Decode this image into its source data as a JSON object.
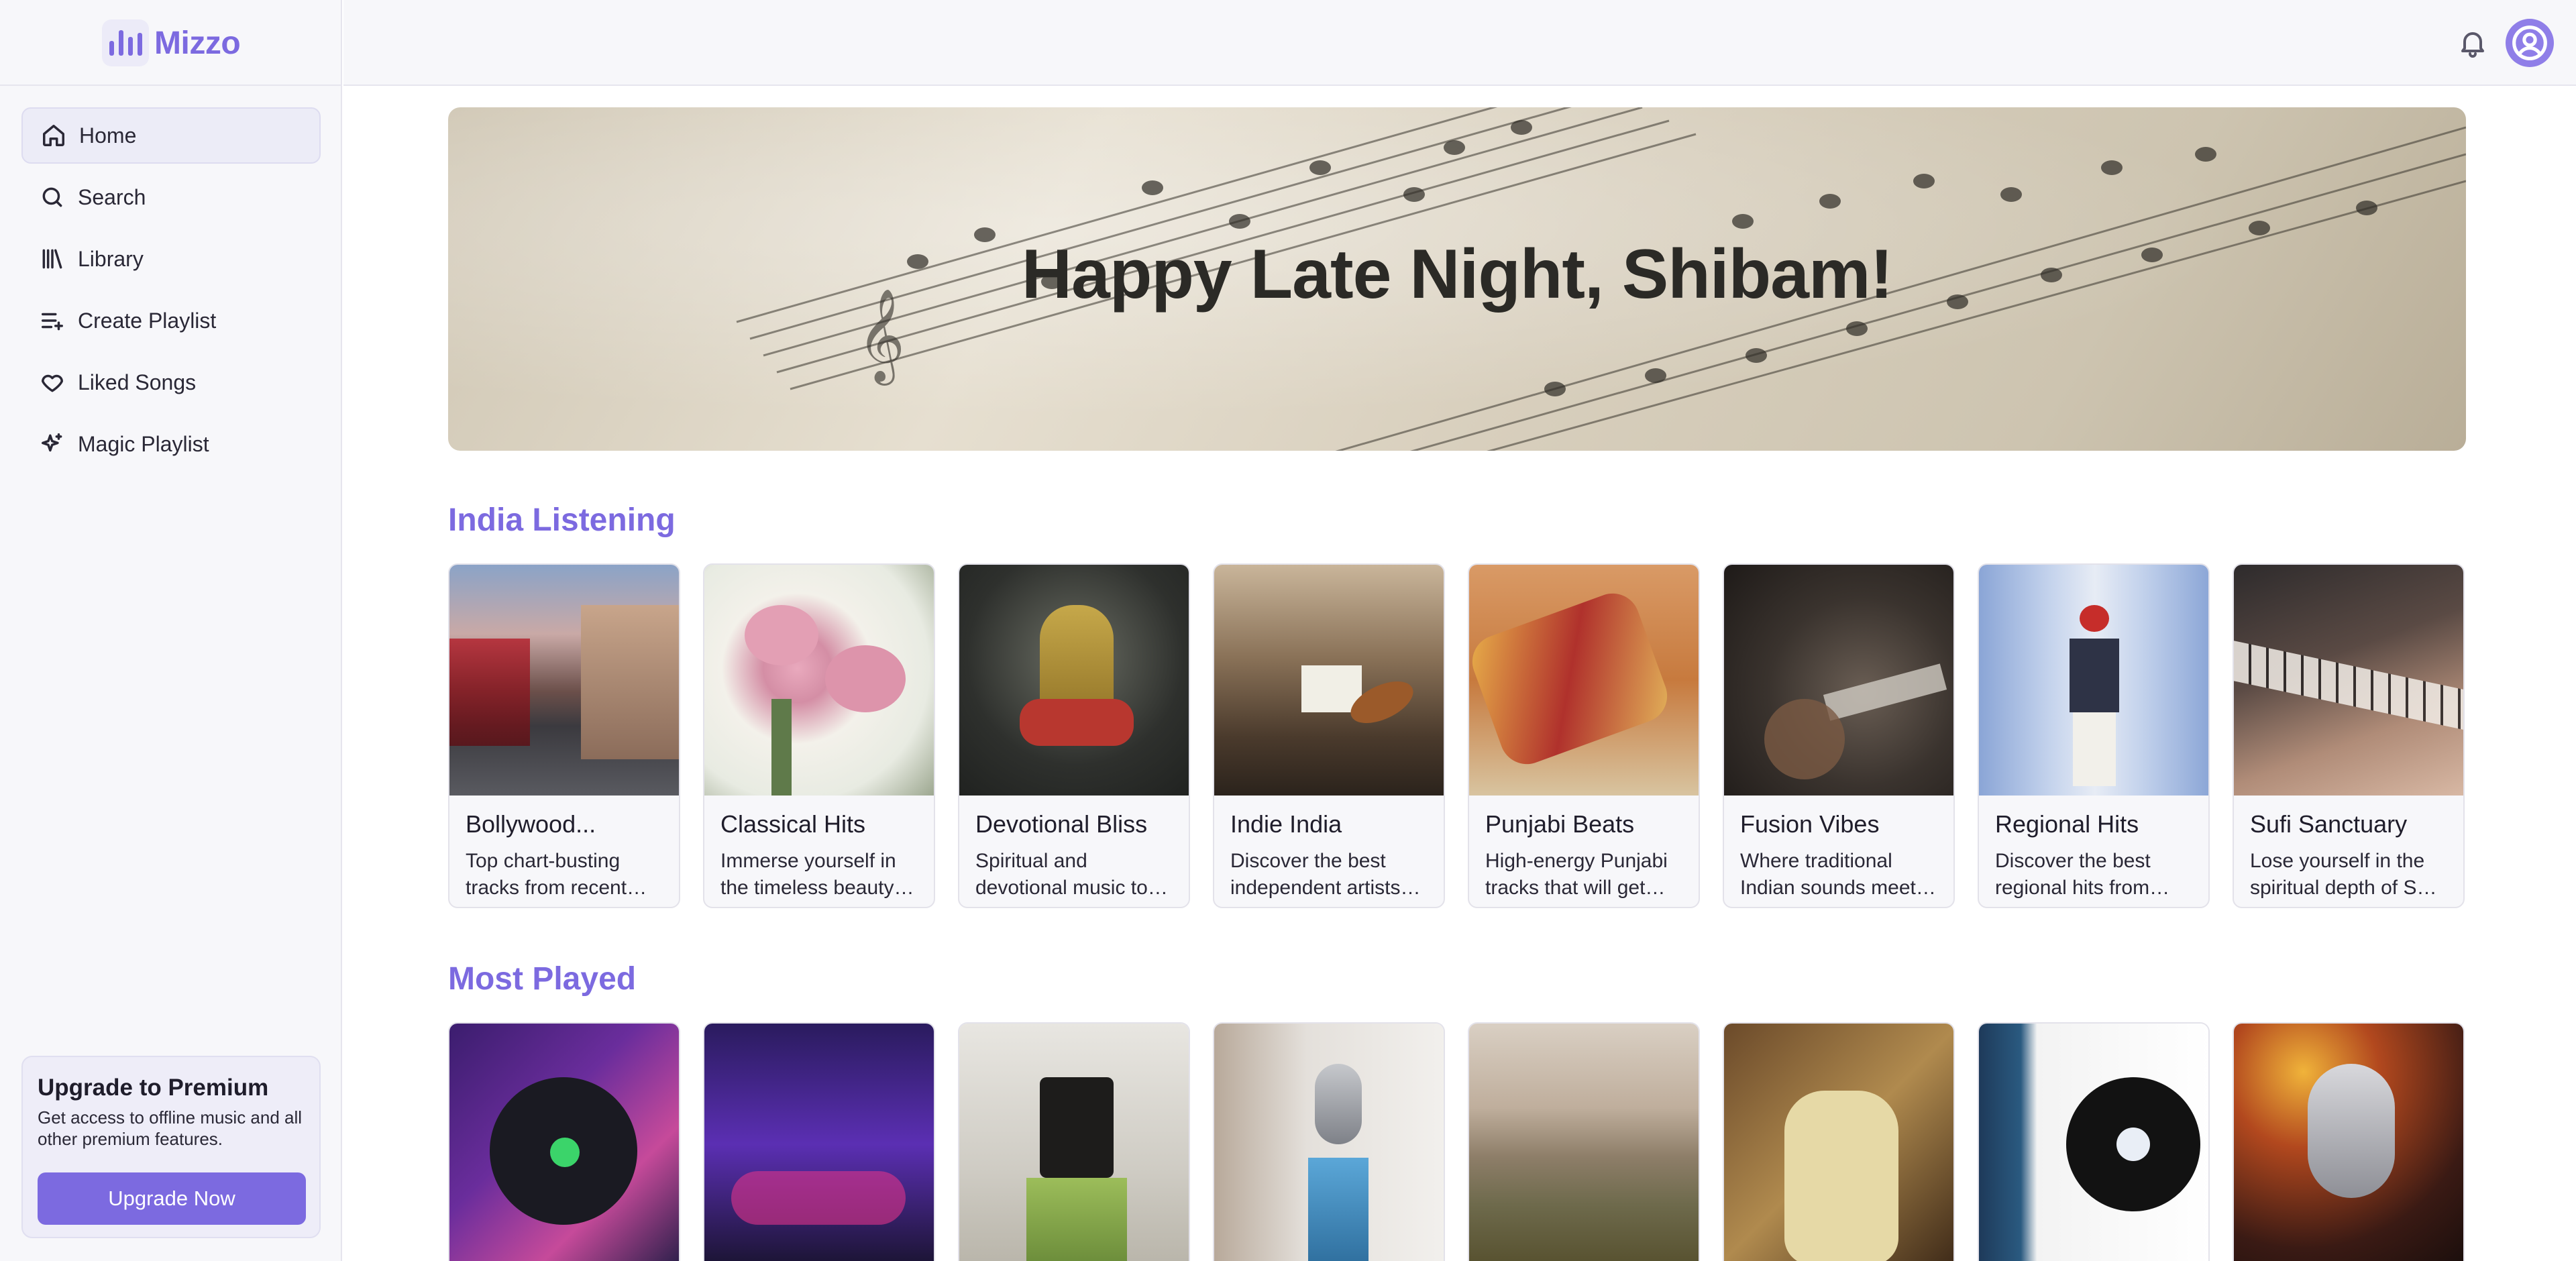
{
  "brand": {
    "name": "Mizzo",
    "icon": "bar-chart-logo-icon",
    "accent": "#7c6ae0"
  },
  "sidebar": {
    "items": [
      {
        "label": "Home",
        "icon": "home-icon",
        "active": true
      },
      {
        "label": "Search",
        "icon": "search-icon"
      },
      {
        "label": "Library",
        "icon": "library-icon"
      },
      {
        "label": "Create Playlist",
        "icon": "add-list-icon"
      },
      {
        "label": "Liked Songs",
        "icon": "heart-icon"
      },
      {
        "label": "Magic Playlist",
        "icon": "sparkle-icon"
      }
    ],
    "premium": {
      "title": "Upgrade to Premium",
      "description": "Get access to offline music and all other premium features.",
      "button": "Upgrade Now"
    }
  },
  "topbar": {
    "notifications_icon": "bell-icon",
    "profile_icon": "user-circle-icon"
  },
  "hero": {
    "greeting": "Happy Late Night, Shibam!"
  },
  "sections": [
    {
      "title": "India Listening",
      "cards": [
        {
          "title": "Bollywood...",
          "description": "Top chart-busting tracks from recent Bollywood releases."
        },
        {
          "title": "Classical Hits",
          "description": "Immerse yourself in the timeless beauty of classical music."
        },
        {
          "title": "Devotional Bliss",
          "description": "Spiritual and devotional music to soothe the soul."
        },
        {
          "title": "Indie India",
          "description": "Discover the best independent artists from India."
        },
        {
          "title": "Punjabi Beats",
          "description": "High-energy Punjabi tracks that will get you moving."
        },
        {
          "title": "Fusion Vibes",
          "description": "Where traditional Indian sounds meet modern beats."
        },
        {
          "title": "Regional Hits",
          "description": "Discover the best regional hits from across India."
        },
        {
          "title": "Sufi Sanctuary",
          "description": "Lose yourself in the spiritual depth of Sufi music."
        }
      ]
    },
    {
      "title": "Most Played",
      "cards": [
        {},
        {},
        {},
        {},
        {},
        {},
        {},
        {}
      ]
    }
  ]
}
